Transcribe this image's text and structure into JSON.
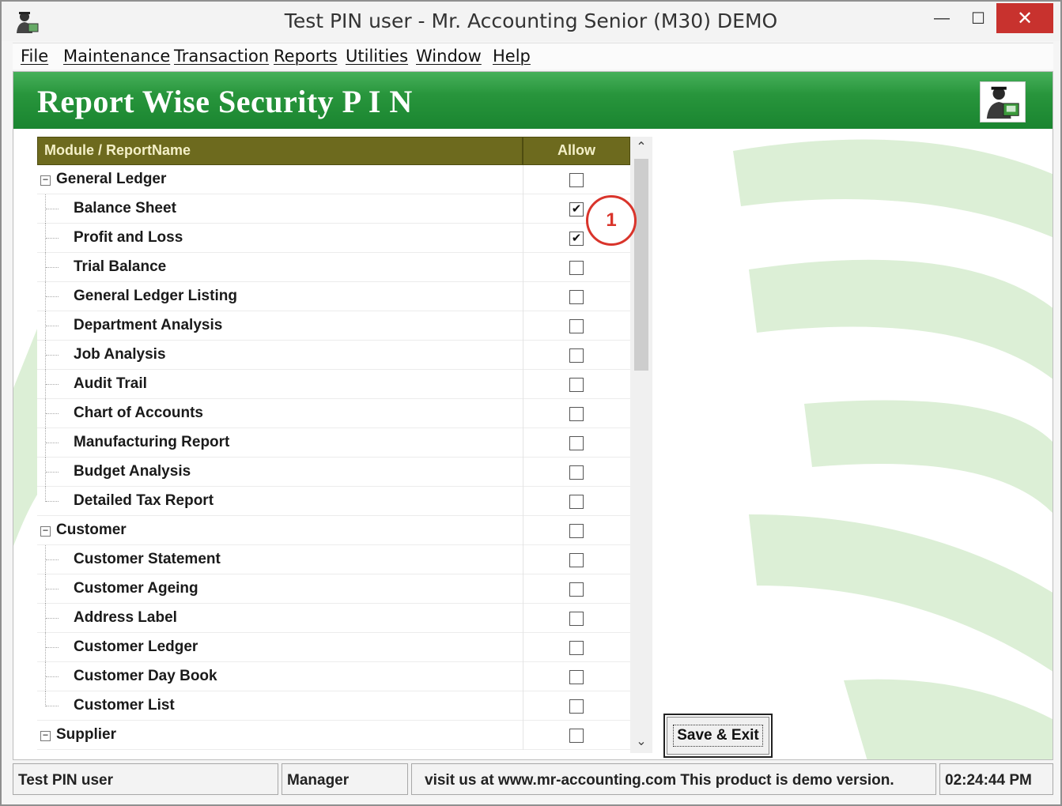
{
  "window": {
    "title": "Test PIN user - Mr. Accounting Senior (M30) DEMO",
    "minimize_glyph": "—",
    "maximize_glyph": "☐",
    "close_glyph": "✕"
  },
  "menu": {
    "items": [
      "File",
      "Maintenance",
      "Transaction",
      "Reports",
      "Utilities",
      "Window",
      "Help"
    ]
  },
  "header": {
    "title": "Report Wise Security P I N"
  },
  "grid": {
    "col_module": "Module / ReportName",
    "col_allow": "Allow",
    "rows": [
      {
        "label": "General Ledger",
        "level": 0,
        "checked": false,
        "expander": "−"
      },
      {
        "label": "Balance Sheet",
        "level": 1,
        "checked": true
      },
      {
        "label": "Profit and Loss",
        "level": 1,
        "checked": true
      },
      {
        "label": "Trial Balance",
        "level": 1,
        "checked": false
      },
      {
        "label": "General Ledger Listing",
        "level": 1,
        "checked": false
      },
      {
        "label": "Department Analysis",
        "level": 1,
        "checked": false
      },
      {
        "label": "Job Analysis",
        "level": 1,
        "checked": false
      },
      {
        "label": "Audit Trail",
        "level": 1,
        "checked": false
      },
      {
        "label": "Chart of Accounts",
        "level": 1,
        "checked": false
      },
      {
        "label": "Manufacturing Report",
        "level": 1,
        "checked": false
      },
      {
        "label": "Budget Analysis",
        "level": 1,
        "checked": false
      },
      {
        "label": "Detailed Tax Report",
        "level": 1,
        "checked": false
      },
      {
        "label": "Customer",
        "level": 0,
        "checked": false,
        "expander": "−"
      },
      {
        "label": "Customer Statement",
        "level": 1,
        "checked": false
      },
      {
        "label": "Customer Ageing",
        "level": 1,
        "checked": false
      },
      {
        "label": "Address Label",
        "level": 1,
        "checked": false
      },
      {
        "label": "Customer Ledger",
        "level": 1,
        "checked": false
      },
      {
        "label": "Customer Day Book",
        "level": 1,
        "checked": false
      },
      {
        "label": "Customer List",
        "level": 1,
        "checked": false
      },
      {
        "label": "Supplier",
        "level": 0,
        "checked": false,
        "expander": "−"
      }
    ]
  },
  "scrollbar": {
    "up_glyph": "⌃",
    "down_glyph": "⌄"
  },
  "callout": {
    "label": "1"
  },
  "save_button": {
    "label": "Save & Exit"
  },
  "status": {
    "user": "Test PIN user",
    "role": "Manager",
    "message": "visit us at www.mr-accounting.com This product is demo version.",
    "time": "02:24:44 PM"
  },
  "colors": {
    "banner_green": "#28953c",
    "grid_header": "#6d6a1e",
    "close_red": "#c8322e",
    "callout_red": "#d9342b"
  }
}
